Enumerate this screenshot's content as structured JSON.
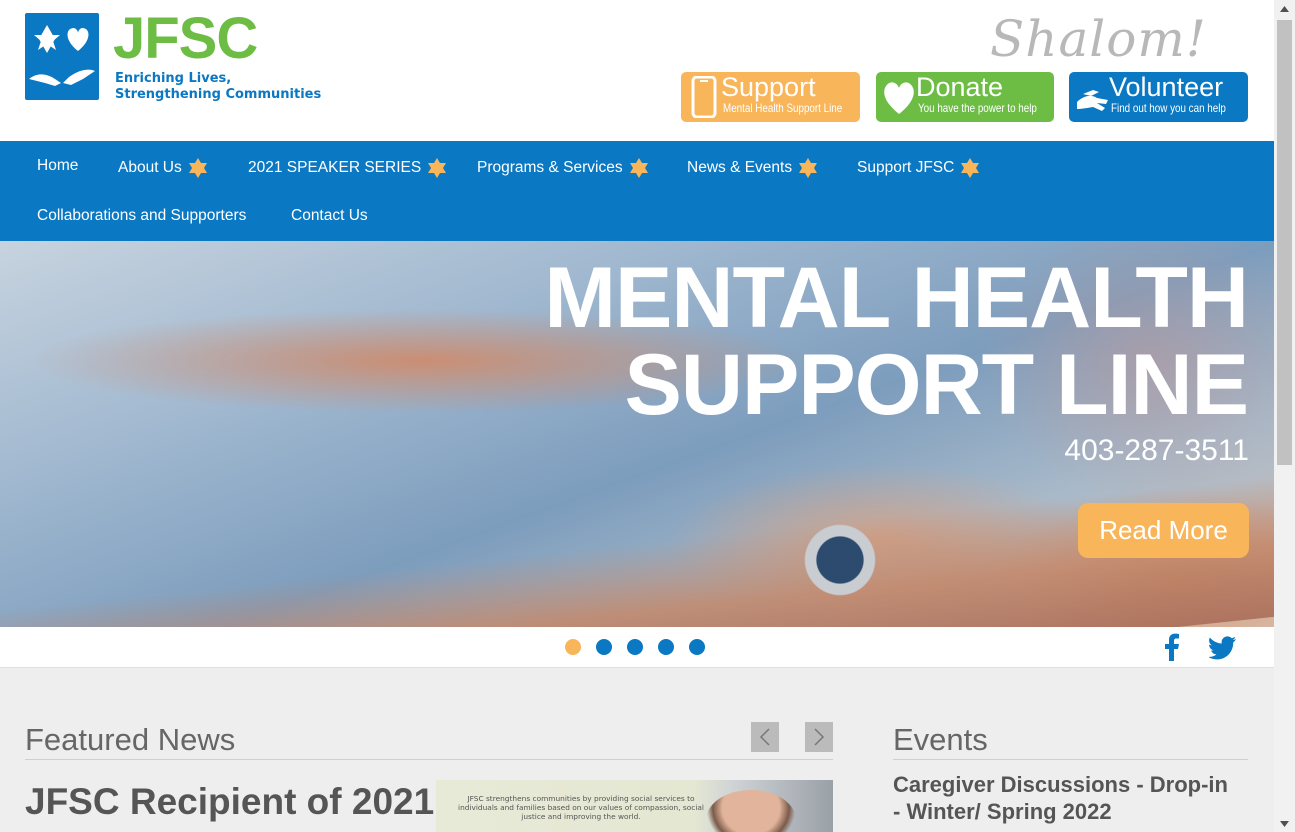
{
  "header": {
    "logo_text": "JFSC",
    "tagline_line1": "Enriching Lives,",
    "tagline_line2": "Strengthening Communities",
    "greeting": "Shalom!"
  },
  "cta": {
    "support": {
      "title": "Support",
      "subtitle": "Mental Health Support Line",
      "icon": "phone-icon"
    },
    "donate": {
      "title": "Donate",
      "subtitle": "You have the power to help",
      "icon": "heart-icon"
    },
    "volunteer": {
      "title": "Volunteer",
      "subtitle": "Find out how you can help",
      "icon": "hand-icon"
    }
  },
  "nav": {
    "items": [
      {
        "label": "Home"
      },
      {
        "label": "About Us"
      },
      {
        "label": "2021 SPEAKER SERIES"
      },
      {
        "label": "Programs & Services"
      },
      {
        "label": "News & Events"
      },
      {
        "label": "Support JFSC"
      },
      {
        "label": "Collaborations and Supporters"
      },
      {
        "label": "Contact Us"
      }
    ],
    "dropdown_icon": "star-of-david-icon"
  },
  "hero": {
    "title_line1": "MENTAL HEALTH",
    "title_line2": "SUPPORT LINE",
    "phone": "403-287-3511",
    "button": "Read More",
    "slide_count": 5,
    "active_slide": 1
  },
  "social": {
    "facebook_icon": "facebook-icon",
    "twitter_icon": "twitter-icon"
  },
  "featured_news": {
    "title": "Featured News",
    "headline": "JFSC Recipient of 2021",
    "image_text": "JFSC strengthens communities by providing social services to individuals and families based on our values of compassion, social justice and improving the world."
  },
  "events": {
    "title": "Events",
    "first_event": "Caregiver Discussions - Drop-in - Winter/ Spring 2022"
  },
  "colors": {
    "brand_blue": "#0a78c2",
    "brand_green": "#6dbd45",
    "accent_orange": "#f8b55a"
  }
}
